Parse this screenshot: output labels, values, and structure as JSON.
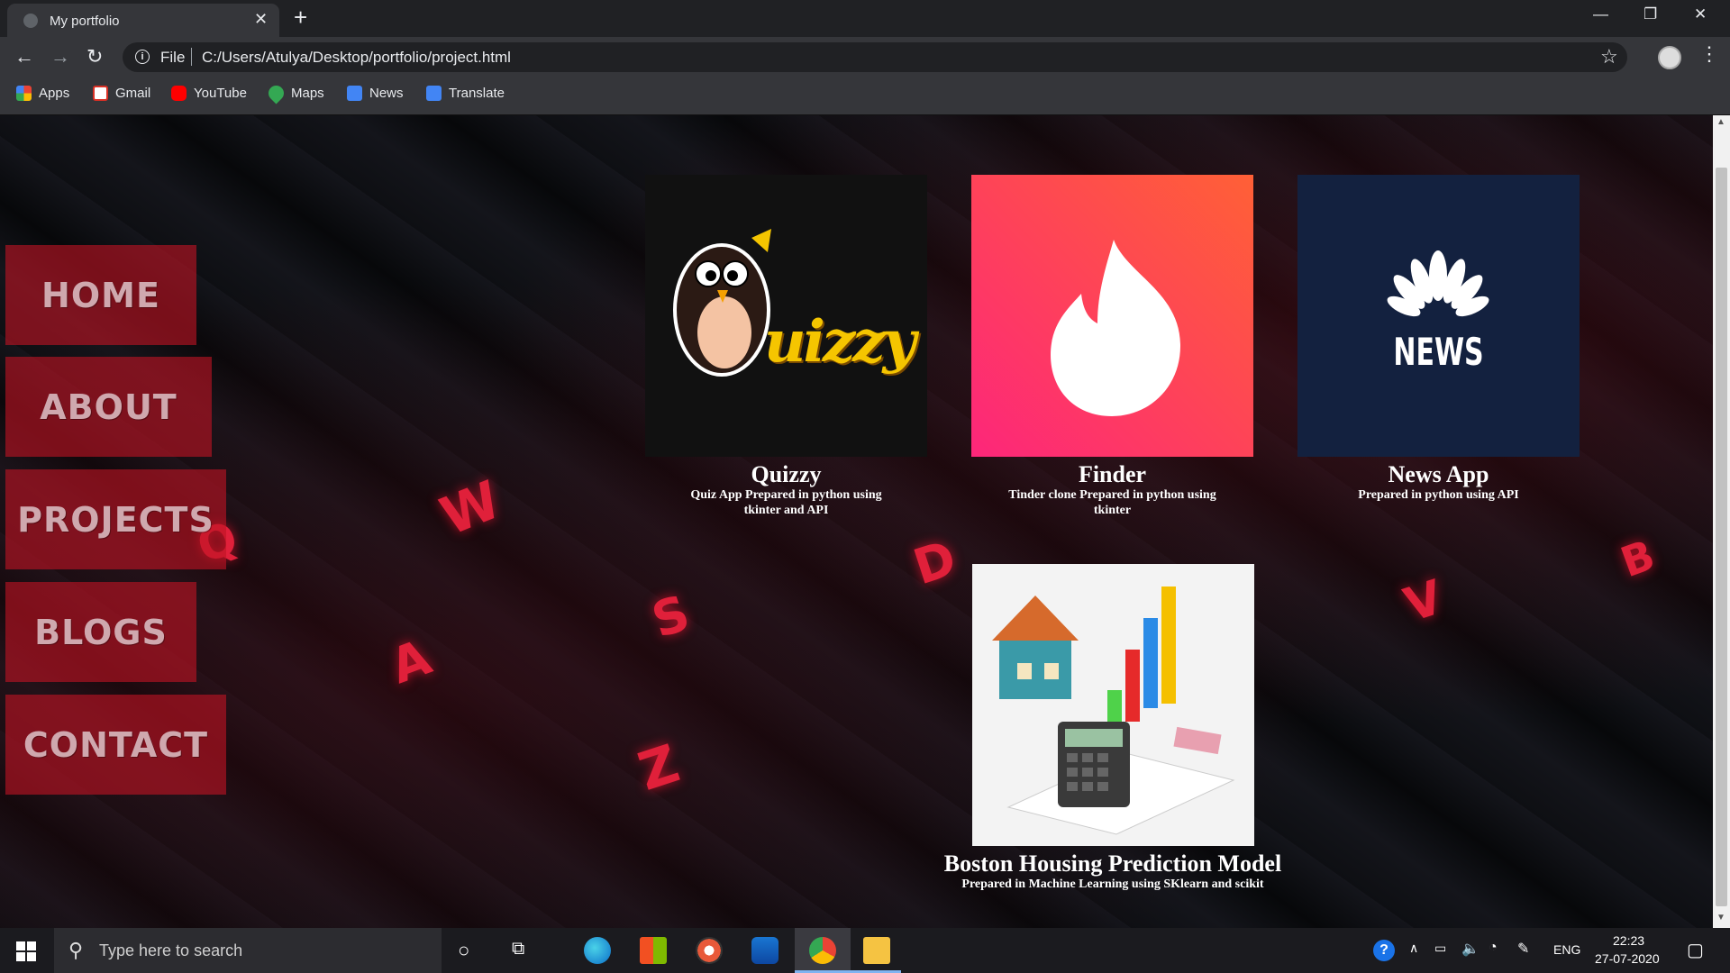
{
  "browser": {
    "tab_title": "My portfolio",
    "tab_close": "✕",
    "new_tab": "+",
    "window_minimize": "—",
    "window_restore": "❐",
    "window_close": "✕",
    "back": "←",
    "forward": "→",
    "reload": "↻",
    "scheme": "File",
    "url": "C:/Users/Atulya/Desktop/portfolio/project.html",
    "star": "☆",
    "menu": "⋮",
    "bookmarks": [
      {
        "label": "Apps",
        "icon": "apps-grid-icon",
        "color": "#ea4335"
      },
      {
        "label": "Gmail",
        "icon": "gmail-icon",
        "color": "#d93025"
      },
      {
        "label": "YouTube",
        "icon": "youtube-icon",
        "color": "#ff0000"
      },
      {
        "label": "Maps",
        "icon": "maps-pin-icon",
        "color": "#34a853"
      },
      {
        "label": "News",
        "icon": "news-icon",
        "color": "#4285f4"
      },
      {
        "label": "Translate",
        "icon": "translate-icon",
        "color": "#4285f4"
      }
    ]
  },
  "page": {
    "nav": [
      "HOME",
      "ABOUT",
      "PROJECTS",
      "BLOGS",
      "CONTACT"
    ],
    "projects": [
      {
        "title": "Quizzy",
        "desc": "Quiz App Prepared in python using tkinter and API",
        "logo_text": "uizzy"
      },
      {
        "title": "Finder",
        "desc": "Tinder clone Prepared in python using tkinter"
      },
      {
        "title": "News App",
        "desc": "Prepared in python using API",
        "logo_text": "NEWS"
      },
      {
        "title": "Boston Housing Prediction Model",
        "desc": "Prepared in Machine Learning using SKlearn and scikit"
      }
    ],
    "key_letters": [
      "W",
      "Q",
      "S",
      "D",
      "A",
      "Z",
      "V",
      "B"
    ]
  },
  "taskbar": {
    "search_placeholder": "Type here to search",
    "lang": "ENG",
    "time": "22:23",
    "date": "27-07-2020"
  },
  "colors": {
    "nav_bg": "#be1423",
    "accent_red": "#e0203a",
    "finder_gradient_top": "#fe5f50",
    "finder_gradient_bottom": "#fd267a",
    "news_bg": "#13213f"
  }
}
